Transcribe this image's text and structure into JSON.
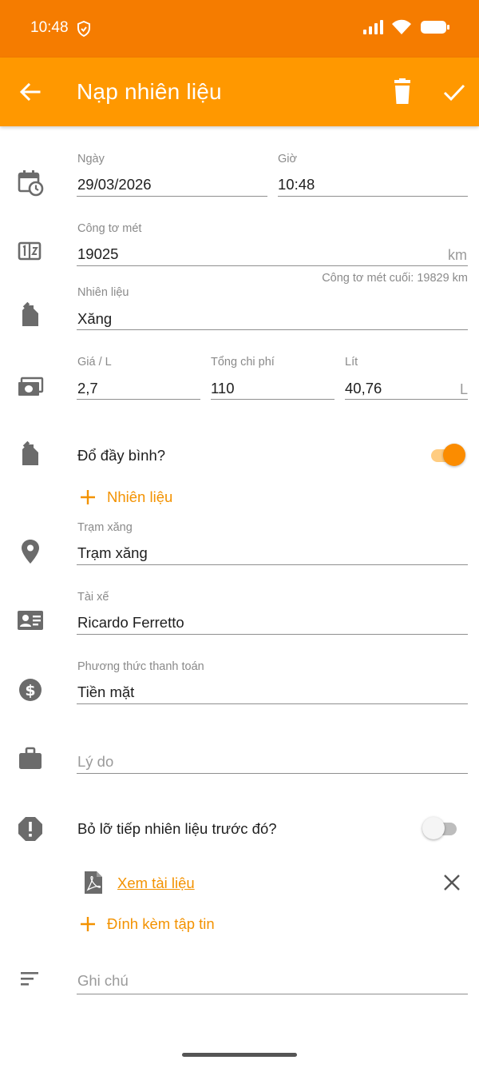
{
  "status_bar": {
    "time": "10:48"
  },
  "app_bar": {
    "title": "Nạp nhiên liệu"
  },
  "form": {
    "date": {
      "label": "Ngày",
      "value": "29/03/2026"
    },
    "time": {
      "label": "Giờ",
      "value": "10:48"
    },
    "odometer": {
      "label": "Công tơ mét",
      "value": "19025",
      "unit": "km",
      "hint": "Công tơ mét cuối: 19829 km"
    },
    "fuel": {
      "label": "Nhiên liệu",
      "value": "Xăng"
    },
    "price": {
      "label": "Giá / L",
      "value": "2,7"
    },
    "total_cost": {
      "label": "Tổng chi phí",
      "value": "110"
    },
    "liters": {
      "label": "Lít",
      "value": "40,76",
      "unit": "L"
    },
    "full_tank": {
      "label": "Đổ đầy bình?",
      "checked": true
    },
    "add_fuel": {
      "label": "Nhiên liệu"
    },
    "station": {
      "label": "Trạm xăng",
      "value": "Trạm xăng"
    },
    "driver": {
      "label": "Tài xế",
      "value": "Ricardo Ferretto"
    },
    "payment": {
      "label": "Phương thức thanh toán",
      "value": "Tiền mặt"
    },
    "reason": {
      "placeholder": "Lý do"
    },
    "missed_previous": {
      "label": "Bỏ lỡ tiếp nhiên liệu trước đó?",
      "checked": false
    },
    "attachment": {
      "link": "Xem tài liệu"
    },
    "attach_file": {
      "label": "Đính kèm tập tin"
    },
    "notes": {
      "placeholder": "Ghi chú"
    }
  },
  "colors": {
    "status_bar": "#f57c00",
    "app_bar": "#ff9800",
    "accent": "#f39200"
  }
}
